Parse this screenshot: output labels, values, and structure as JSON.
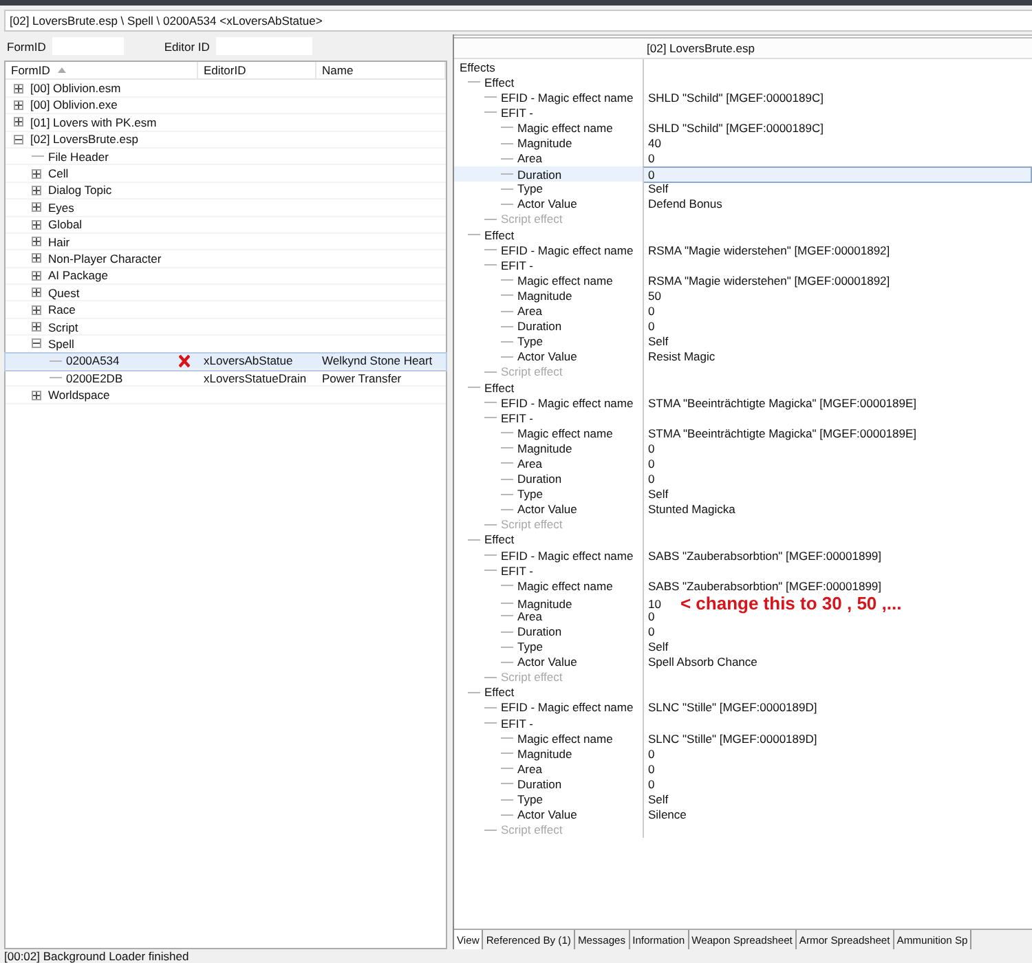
{
  "path": "[02] LoversBrute.esp \\ Spell \\ 0200A534 <xLoversAbStatue>",
  "filter": {
    "formid_label": "FormID",
    "editorid_label": "Editor ID"
  },
  "left": {
    "columns": [
      {
        "label": "FormID",
        "sorted": true
      },
      {
        "label": "EditorID",
        "sorted": false
      },
      {
        "label": "Name",
        "sorted": false
      }
    ],
    "tree": [
      {
        "label": "[00] Oblivion.esm",
        "expanded": false,
        "selected": false
      },
      {
        "label": "[00] Oblivion.exe",
        "expanded": false,
        "selected": false
      },
      {
        "label": "[01] Lovers with PK.esm",
        "expanded": false,
        "selected": false
      },
      {
        "label": "[02] LoversBrute.esp",
        "expanded": true,
        "selected": false,
        "children": [
          {
            "label": "File Header",
            "selected": false
          },
          {
            "label": "Cell",
            "expanded": false,
            "selected": false
          },
          {
            "label": "Dialog Topic",
            "expanded": false,
            "selected": false
          },
          {
            "label": "Eyes",
            "expanded": false,
            "selected": false
          },
          {
            "label": "Global",
            "expanded": false,
            "selected": false
          },
          {
            "label": "Hair",
            "expanded": false,
            "selected": false
          },
          {
            "label": "Non-Player Character",
            "expanded": false,
            "selected": false
          },
          {
            "label": "AI Package",
            "expanded": false,
            "selected": false
          },
          {
            "label": "Quest",
            "expanded": false,
            "selected": false
          },
          {
            "label": "Race",
            "expanded": false,
            "selected": false
          },
          {
            "label": "Script",
            "expanded": false,
            "selected": false
          },
          {
            "label": "Spell",
            "expanded": true,
            "selected": false,
            "children": [
              {
                "label": "0200A534",
                "editor_id": "xLoversAbStatue",
                "name": "Welkynd Stone Heart",
                "selected": true,
                "marked": true
              },
              {
                "label": "0200E2DB",
                "editor_id": "xLoversStatueDrain",
                "name": "Power Transfer",
                "selected": false,
                "marked": false
              }
            ]
          },
          {
            "label": "Worldspace",
            "expanded": false,
            "selected": false
          }
        ]
      }
    ]
  },
  "right": {
    "header": "[02] LoversBrute.esp",
    "tree": [
      {
        "label": "Effects",
        "selected": false,
        "disabled": false,
        "children": [
          {
            "label": "Effect",
            "selected": false,
            "disabled": false,
            "children": [
              {
                "label": "EFID - Magic effect name",
                "value": "SHLD \"Schild\" [MGEF:0000189C]",
                "selected": false,
                "disabled": false
              },
              {
                "label": "EFIT -",
                "selected": false,
                "disabled": false,
                "children": [
                  {
                    "label": "Magic effect name",
                    "value": "SHLD \"Schild\" [MGEF:0000189C]",
                    "selected": false,
                    "disabled": false
                  },
                  {
                    "label": "Magnitude",
                    "value": "40",
                    "selected": false,
                    "disabled": false
                  },
                  {
                    "label": "Area",
                    "value": "0",
                    "selected": false,
                    "disabled": false
                  },
                  {
                    "label": "Duration",
                    "value": "0",
                    "selected": true,
                    "disabled": false
                  },
                  {
                    "label": "Type",
                    "value": "Self",
                    "selected": false,
                    "disabled": false
                  },
                  {
                    "label": "Actor Value",
                    "value": "Defend Bonus",
                    "selected": false,
                    "disabled": false
                  }
                ]
              },
              {
                "label": "Script effect",
                "selected": false,
                "disabled": true
              }
            ]
          },
          {
            "label": "Effect",
            "selected": false,
            "disabled": false,
            "children": [
              {
                "label": "EFID - Magic effect name",
                "value": "RSMA \"Magie widerstehen\" [MGEF:00001892]",
                "selected": false,
                "disabled": false
              },
              {
                "label": "EFIT -",
                "selected": false,
                "disabled": false,
                "children": [
                  {
                    "label": "Magic effect name",
                    "value": "RSMA \"Magie widerstehen\" [MGEF:00001892]",
                    "selected": false,
                    "disabled": false
                  },
                  {
                    "label": "Magnitude",
                    "value": "50",
                    "selected": false,
                    "disabled": false
                  },
                  {
                    "label": "Area",
                    "value": "0",
                    "selected": false,
                    "disabled": false
                  },
                  {
                    "label": "Duration",
                    "value": "0",
                    "selected": false,
                    "disabled": false
                  },
                  {
                    "label": "Type",
                    "value": "Self",
                    "selected": false,
                    "disabled": false
                  },
                  {
                    "label": "Actor Value",
                    "value": "Resist Magic",
                    "selected": false,
                    "disabled": false
                  }
                ]
              },
              {
                "label": "Script effect",
                "selected": false,
                "disabled": true
              }
            ]
          },
          {
            "label": "Effect",
            "selected": false,
            "disabled": false,
            "children": [
              {
                "label": "EFID - Magic effect name",
                "value": "STMA \"Beeinträchtigte Magicka\" [MGEF:0000189E]",
                "selected": false,
                "disabled": false
              },
              {
                "label": "EFIT -",
                "selected": false,
                "disabled": false,
                "children": [
                  {
                    "label": "Magic effect name",
                    "value": "STMA \"Beeinträchtigte Magicka\" [MGEF:0000189E]",
                    "selected": false,
                    "disabled": false
                  },
                  {
                    "label": "Magnitude",
                    "value": "0",
                    "selected": false,
                    "disabled": false
                  },
                  {
                    "label": "Area",
                    "value": "0",
                    "selected": false,
                    "disabled": false
                  },
                  {
                    "label": "Duration",
                    "value": "0",
                    "selected": false,
                    "disabled": false
                  },
                  {
                    "label": "Type",
                    "value": "Self",
                    "selected": false,
                    "disabled": false
                  },
                  {
                    "label": "Actor Value",
                    "value": "Stunted Magicka",
                    "selected": false,
                    "disabled": false
                  }
                ]
              },
              {
                "label": "Script effect",
                "selected": false,
                "disabled": true
              }
            ]
          },
          {
            "label": "Effect",
            "selected": false,
            "disabled": false,
            "children": [
              {
                "label": "EFID - Magic effect name",
                "value": "SABS \"Zauberabsorbtion\" [MGEF:00001899]",
                "selected": false,
                "disabled": false
              },
              {
                "label": "EFIT -",
                "selected": false,
                "disabled": false,
                "children": [
                  {
                    "label": "Magic effect name",
                    "value": "SABS \"Zauberabsorbtion\" [MGEF:00001899]",
                    "selected": false,
                    "disabled": false
                  },
                  {
                    "label": "Magnitude",
                    "value": "10",
                    "note": "<  change this to 30 , 50 ,...",
                    "selected": false,
                    "disabled": false
                  },
                  {
                    "label": "Area",
                    "value": "0",
                    "selected": false,
                    "disabled": false
                  },
                  {
                    "label": "Duration",
                    "value": "0",
                    "selected": false,
                    "disabled": false
                  },
                  {
                    "label": "Type",
                    "value": "Self",
                    "selected": false,
                    "disabled": false
                  },
                  {
                    "label": "Actor Value",
                    "value": "Spell Absorb Chance",
                    "selected": false,
                    "disabled": false
                  }
                ]
              },
              {
                "label": "Script effect",
                "selected": false,
                "disabled": true
              }
            ]
          },
          {
            "label": "Effect",
            "selected": false,
            "disabled": false,
            "children": [
              {
                "label": "EFID - Magic effect name",
                "value": "SLNC \"Stille\" [MGEF:0000189D]",
                "selected": false,
                "disabled": false
              },
              {
                "label": "EFIT -",
                "selected": false,
                "disabled": false,
                "children": [
                  {
                    "label": "Magic effect name",
                    "value": "SLNC \"Stille\" [MGEF:0000189D]",
                    "selected": false,
                    "disabled": false
                  },
                  {
                    "label": "Magnitude",
                    "value": "0",
                    "selected": false,
                    "disabled": false
                  },
                  {
                    "label": "Area",
                    "value": "0",
                    "selected": false,
                    "disabled": false
                  },
                  {
                    "label": "Duration",
                    "value": "0",
                    "selected": false,
                    "disabled": false
                  },
                  {
                    "label": "Type",
                    "value": "Self",
                    "selected": false,
                    "disabled": false
                  },
                  {
                    "label": "Actor Value",
                    "value": "Silence",
                    "selected": false,
                    "disabled": false
                  }
                ]
              },
              {
                "label": "Script effect",
                "selected": false,
                "disabled": true
              }
            ]
          }
        ]
      }
    ]
  },
  "tabs": [
    {
      "label": "View",
      "selected": true
    },
    {
      "label": "Referenced By (1)",
      "selected": false
    },
    {
      "label": "Messages",
      "selected": false
    },
    {
      "label": "Information",
      "selected": false
    },
    {
      "label": "Weapon Spreadsheet",
      "selected": false
    },
    {
      "label": "Armor Spreadsheet",
      "selected": false
    },
    {
      "label": "Ammunition Sp",
      "selected": false
    }
  ],
  "status": "[00:02] Background Loader finished"
}
